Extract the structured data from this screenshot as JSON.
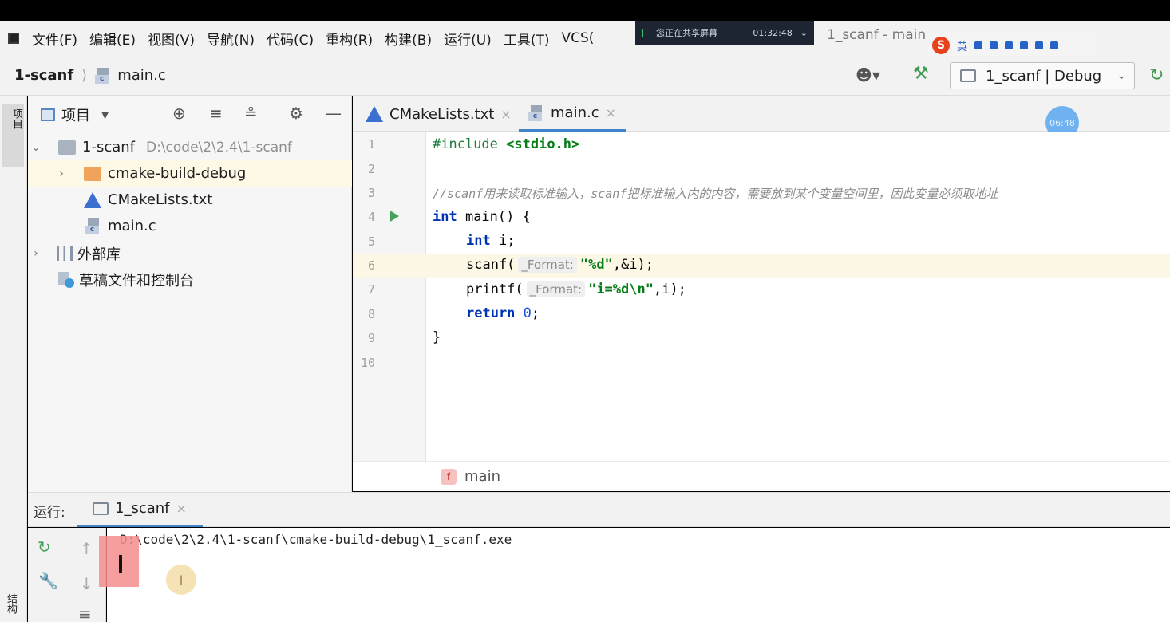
{
  "menu": {
    "items": [
      "文件(F)",
      "编辑(E)",
      "视图(V)",
      "导航(N)",
      "代码(C)",
      "重构(R)",
      "构建(B)",
      "运行(U)",
      "工具(T)",
      "VCS("
    ],
    "window_title": "1_scanf - main"
  },
  "share_overlay": {
    "text": "您正在共享屏幕",
    "time": "01:32:48"
  },
  "ime": {
    "logo": "S",
    "lang": "英"
  },
  "navbar": {
    "project": "1-scanf",
    "file": "main.c",
    "run_config": "1_scanf | Debug"
  },
  "left_stripe": {
    "project": "项目",
    "structure": "结构"
  },
  "project_panel": {
    "title": "项目",
    "tree": [
      {
        "label": "1-scanf",
        "path": "D:\\code\\2\\2.4\\1-scanf"
      },
      {
        "label": "cmake-build-debug"
      },
      {
        "label": "CMakeLists.txt"
      },
      {
        "label": "main.c"
      },
      {
        "label": "外部库"
      },
      {
        "label": "草稿文件和控制台"
      }
    ]
  },
  "editor": {
    "tabs": [
      "CMakeLists.txt",
      "main.c"
    ],
    "time_bubble": "06:48",
    "line_numbers": [
      "1",
      "2",
      "3",
      "4",
      "5",
      "6",
      "7",
      "8",
      "9",
      "10"
    ],
    "code": {
      "l1_directive": "#include",
      "l1_header": "<stdio.h>",
      "l3_comment": "//scanf用来读取标准输入，scanf把标准输入内的内容，需要放到某个变量空间里，因此变量必须取地址",
      "l4_kw": "int",
      "l4_rest": " main() {",
      "l5_kw": "int",
      "l5_rest": " i;",
      "l6_fn": "scanf(",
      "l6_hint": "_Format:",
      "l6_str": "\"%d\"",
      "l6_rest": ",&i);",
      "l7_fn": "printf(",
      "l7_hint": "_Format:",
      "l7_str": "\"i=%d\\n\"",
      "l7_rest": ",i);",
      "l8_kw": "return",
      "l8_num": "0",
      "l8_rest": ";",
      "l9": "}"
    },
    "breadcrumb_fn_icon": "f",
    "breadcrumb_fn": "main"
  },
  "run_panel": {
    "label": "运行:",
    "tab": "1_scanf",
    "console_path": "D:\\code\\2\\2.4\\1-scanf\\cmake-build-debug\\1_scanf.exe",
    "cursor_glyph": "I"
  },
  "icons": {
    "play": "play-icon",
    "user": "user-icon",
    "build": "hammer-icon",
    "rerun": "rerun-icon"
  },
  "colors": {
    "accent": "#4083c9",
    "keyword": "#0033b3",
    "string": "#067d17",
    "comment": "#8c8c8c",
    "run_green": "#47a15a"
  }
}
